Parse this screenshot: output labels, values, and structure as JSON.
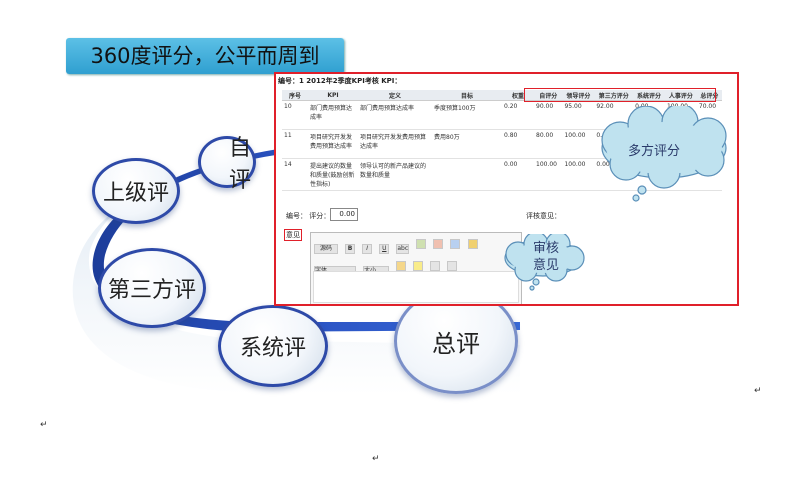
{
  "title": "360度评分，公平而周到",
  "bubbles": {
    "self": "自评",
    "superior": "上级评",
    "third_party": "第三方评",
    "system": "系统评",
    "total": "总评"
  },
  "panel": {
    "header": "编号：1  2012年2季度KPI考核  KPI：",
    "columns": [
      "序号",
      "KPI",
      "定义",
      "目标",
      "权重",
      "自评分",
      "领导评分",
      "第三方评分",
      "系统评分",
      "人事评分",
      "总评分"
    ],
    "rows": [
      [
        "10",
        "部门费用预算达成率",
        "部门费用预算达成率",
        "季度预算100万",
        "0.20",
        "90.00",
        "95.00",
        "92.00",
        "0.00",
        "100.00",
        "70.00"
      ],
      [
        "11",
        "项目研究开发发费用预算达成率",
        "项目研究开发发费用预算达成率",
        "费用80万",
        "0.80",
        "80.00",
        "100.00",
        "0.00",
        "",
        "",
        ""
      ],
      [
        "14",
        "提出建议的数量和质量(鼓励创新性指标)",
        "领导认可的新产品建议的数量和质量",
        "",
        "0.00",
        "100.00",
        "100.00",
        "0.00",
        "",
        "",
        ""
      ]
    ],
    "score_label": "编号：   评分：",
    "score_value": "0.00",
    "opinion_label": "评核意见：",
    "comment_label": "意见",
    "editor": {
      "source_label": "源码",
      "font_family_placeholder": "字体",
      "font_size_placeholder": "大小",
      "buttons": [
        "B",
        "I",
        "U",
        "abc"
      ]
    }
  },
  "callouts": {
    "multi": "多方评分",
    "review": "审核\n意见"
  },
  "return_marks": [
    "↵",
    "↵",
    "↵"
  ]
}
